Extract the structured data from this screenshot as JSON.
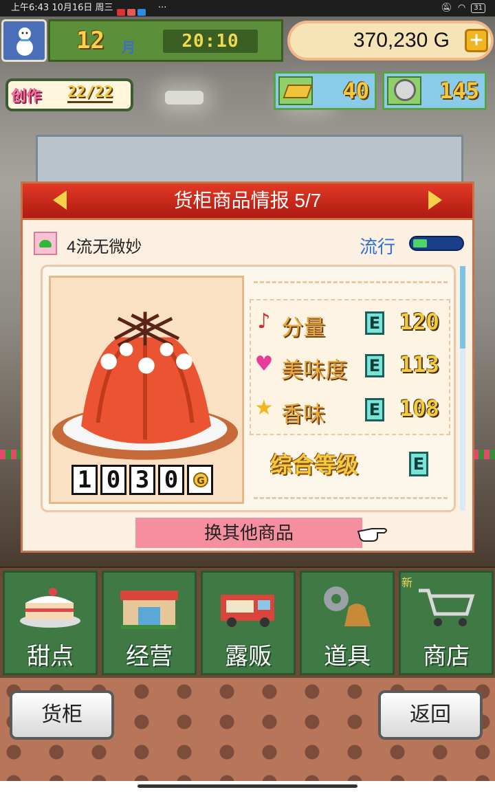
{
  "status_bar": {
    "left_text": "上午6:43 10月16日 周三",
    "right_more": "···",
    "battery": "31"
  },
  "hud": {
    "month_number": "12",
    "month_unit": "月",
    "clock": "20:10",
    "money": "370,230 G",
    "plus_label": "+",
    "create_label": "创作",
    "create_value": "22/22",
    "gold_count": "40",
    "medal_count": "145"
  },
  "dialog": {
    "title": "货柜商品情报 5/7",
    "rank_text": "4流无微妙",
    "trend_label": "流行",
    "trend_level": 0.3,
    "price_digits": [
      "1",
      "0",
      "3",
      "0"
    ],
    "price_unit": "G",
    "stats": [
      {
        "icon": "music-note-icon",
        "label": "分量",
        "grade": "E",
        "value": "120"
      },
      {
        "icon": "heart-icon",
        "label": "美味度",
        "grade": "E",
        "value": "113"
      },
      {
        "icon": "star-icon",
        "label": "香味",
        "grade": "E",
        "value": "108"
      }
    ],
    "overall_label": "综合等级",
    "overall_grade": "E",
    "switch_button": "换其他商品"
  },
  "menu": {
    "items": [
      {
        "label": "甜点",
        "icon": "cake-icon"
      },
      {
        "label": "经营",
        "icon": "shop-icon"
      },
      {
        "label": "露贩",
        "icon": "food-truck-icon"
      },
      {
        "label": "道具",
        "icon": "gear-bag-icon"
      },
      {
        "label": "商店",
        "icon": "cart-icon"
      }
    ],
    "new_tag": "新"
  },
  "bottom": {
    "left_button": "货柜",
    "right_button": "返回"
  },
  "colors": {
    "title_red": "#c8251a",
    "panel_green": "#3f7a45",
    "grade_teal": "#79e3d8",
    "accent_gold": "#f2cd3d"
  }
}
